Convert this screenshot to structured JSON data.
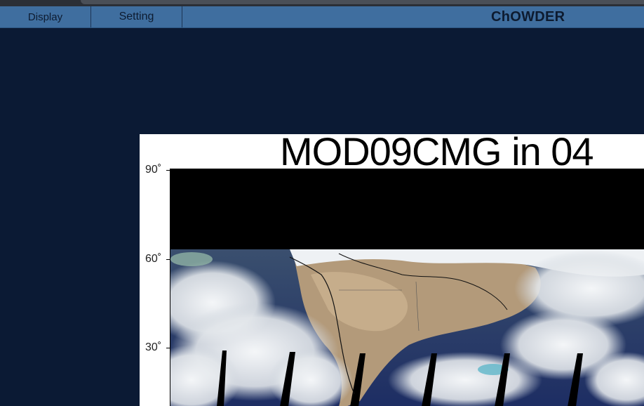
{
  "menubar": {
    "display_label": "Display",
    "setting_label": "Setting",
    "app_title": "ChOWDER"
  },
  "content": {
    "title": "MOD09CMG in 04",
    "lat_labels": [
      "90˚",
      "60˚",
      "30˚"
    ]
  },
  "colors": {
    "background": "#0b1a34",
    "menubar": "#3f6e9f",
    "menu_text": "#0d1b30"
  }
}
